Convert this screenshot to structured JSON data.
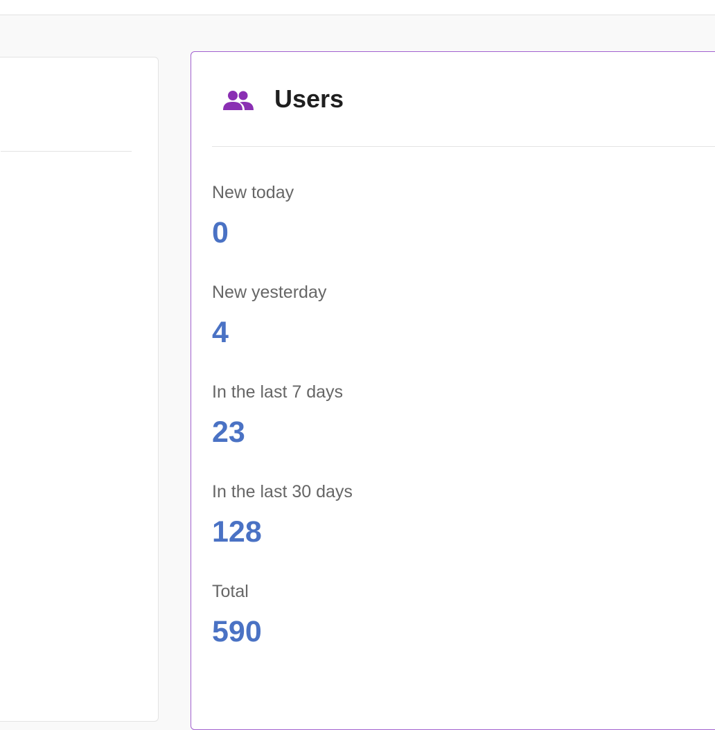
{
  "users_card": {
    "title": "Users",
    "icon": "users-icon",
    "accent_color": "#a15fcf",
    "value_color": "#4a72c4",
    "stats": [
      {
        "label": "New today",
        "value": "0"
      },
      {
        "label": "New yesterday",
        "value": "4"
      },
      {
        "label": "In the last 7 days",
        "value": "23"
      },
      {
        "label": "In the last 30 days",
        "value": "128"
      },
      {
        "label": "Total",
        "value": "590"
      }
    ]
  }
}
